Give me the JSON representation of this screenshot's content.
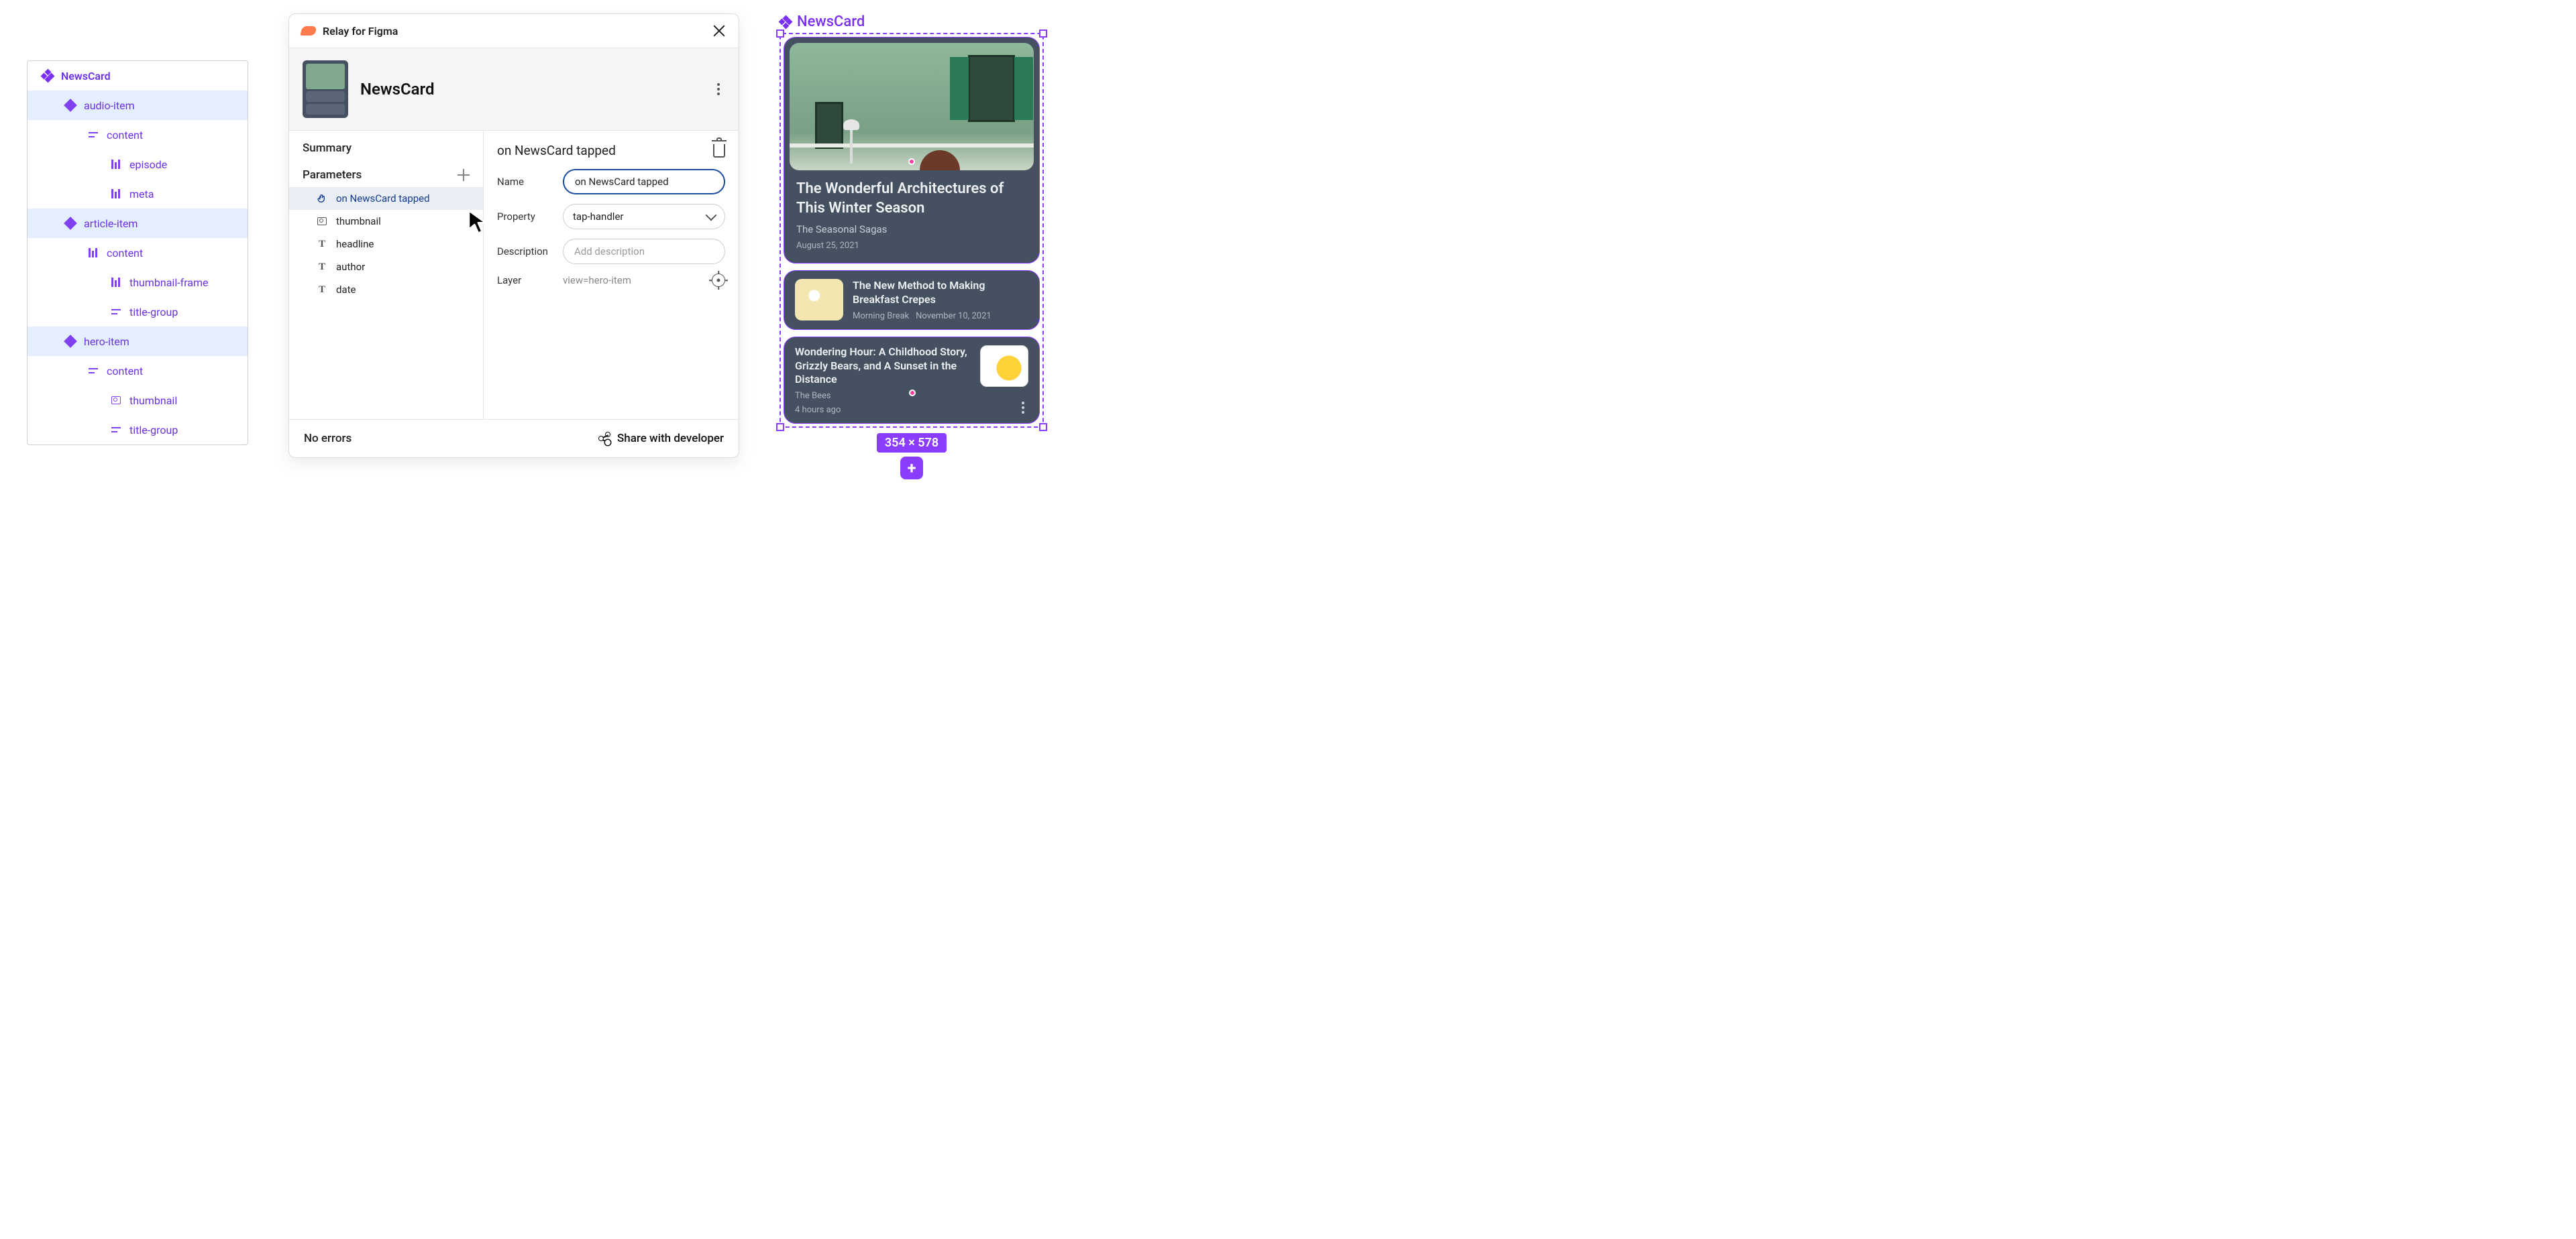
{
  "layerPanel": {
    "root": "NewsCard",
    "items": [
      {
        "label": "audio-item",
        "depth": 1,
        "icon": "component",
        "selected": true
      },
      {
        "label": "content",
        "depth": 2,
        "icon": "lines"
      },
      {
        "label": "episode",
        "depth": 3,
        "icon": "cols"
      },
      {
        "label": "meta",
        "depth": 3,
        "icon": "cols"
      },
      {
        "label": "article-item",
        "depth": 1,
        "icon": "component",
        "selected": true
      },
      {
        "label": "content",
        "depth": 2,
        "icon": "cols"
      },
      {
        "label": "thumbnail-frame",
        "depth": 3,
        "icon": "cols"
      },
      {
        "label": "title-group",
        "depth": 3,
        "icon": "lines"
      },
      {
        "label": "hero-item",
        "depth": 1,
        "icon": "component",
        "selected": true
      },
      {
        "label": "content",
        "depth": 2,
        "icon": "lines"
      },
      {
        "label": "thumbnail",
        "depth": 3,
        "icon": "image"
      },
      {
        "label": "title-group",
        "depth": 3,
        "icon": "lines"
      }
    ]
  },
  "plugin": {
    "title": "Relay for Figma",
    "componentName": "NewsCard",
    "sections": {
      "summary": "Summary",
      "parameters": "Parameters"
    },
    "parameters": [
      {
        "name": "on NewsCard tapped",
        "icon": "tap",
        "selected": true
      },
      {
        "name": "thumbnail",
        "icon": "image"
      },
      {
        "name": "headline",
        "icon": "text"
      },
      {
        "name": "author",
        "icon": "text"
      },
      {
        "name": "date",
        "icon": "text"
      }
    ],
    "detail": {
      "title": "on NewsCard tapped",
      "fields": {
        "nameLabel": "Name",
        "nameValue": "on NewsCard tapped",
        "propertyLabel": "Property",
        "propertyValue": "tap-handler",
        "descriptionLabel": "Description",
        "descriptionPlaceholder": "Add description",
        "layerLabel": "Layer",
        "layerValue": "view=hero-item"
      }
    },
    "footer": {
      "status": "No errors",
      "share": "Share with developer"
    }
  },
  "canvas": {
    "label": "NewsCard",
    "dimensions": "354 × 578",
    "hero": {
      "title": "The Wonderful Architectures of This Winter Season",
      "subtitle": "The Seasonal Sagas",
      "date": "August 25, 2021"
    },
    "article1": {
      "title": "The New Method to Making Breakfast Crepes",
      "author": "Morning Break",
      "date": "November 10, 2021"
    },
    "article2": {
      "title": "Wondering Hour: A Childhood Story, Grizzly Bears, and A Sunset in the Distance",
      "author": "The Bees",
      "time": "4 hours ago"
    }
  }
}
